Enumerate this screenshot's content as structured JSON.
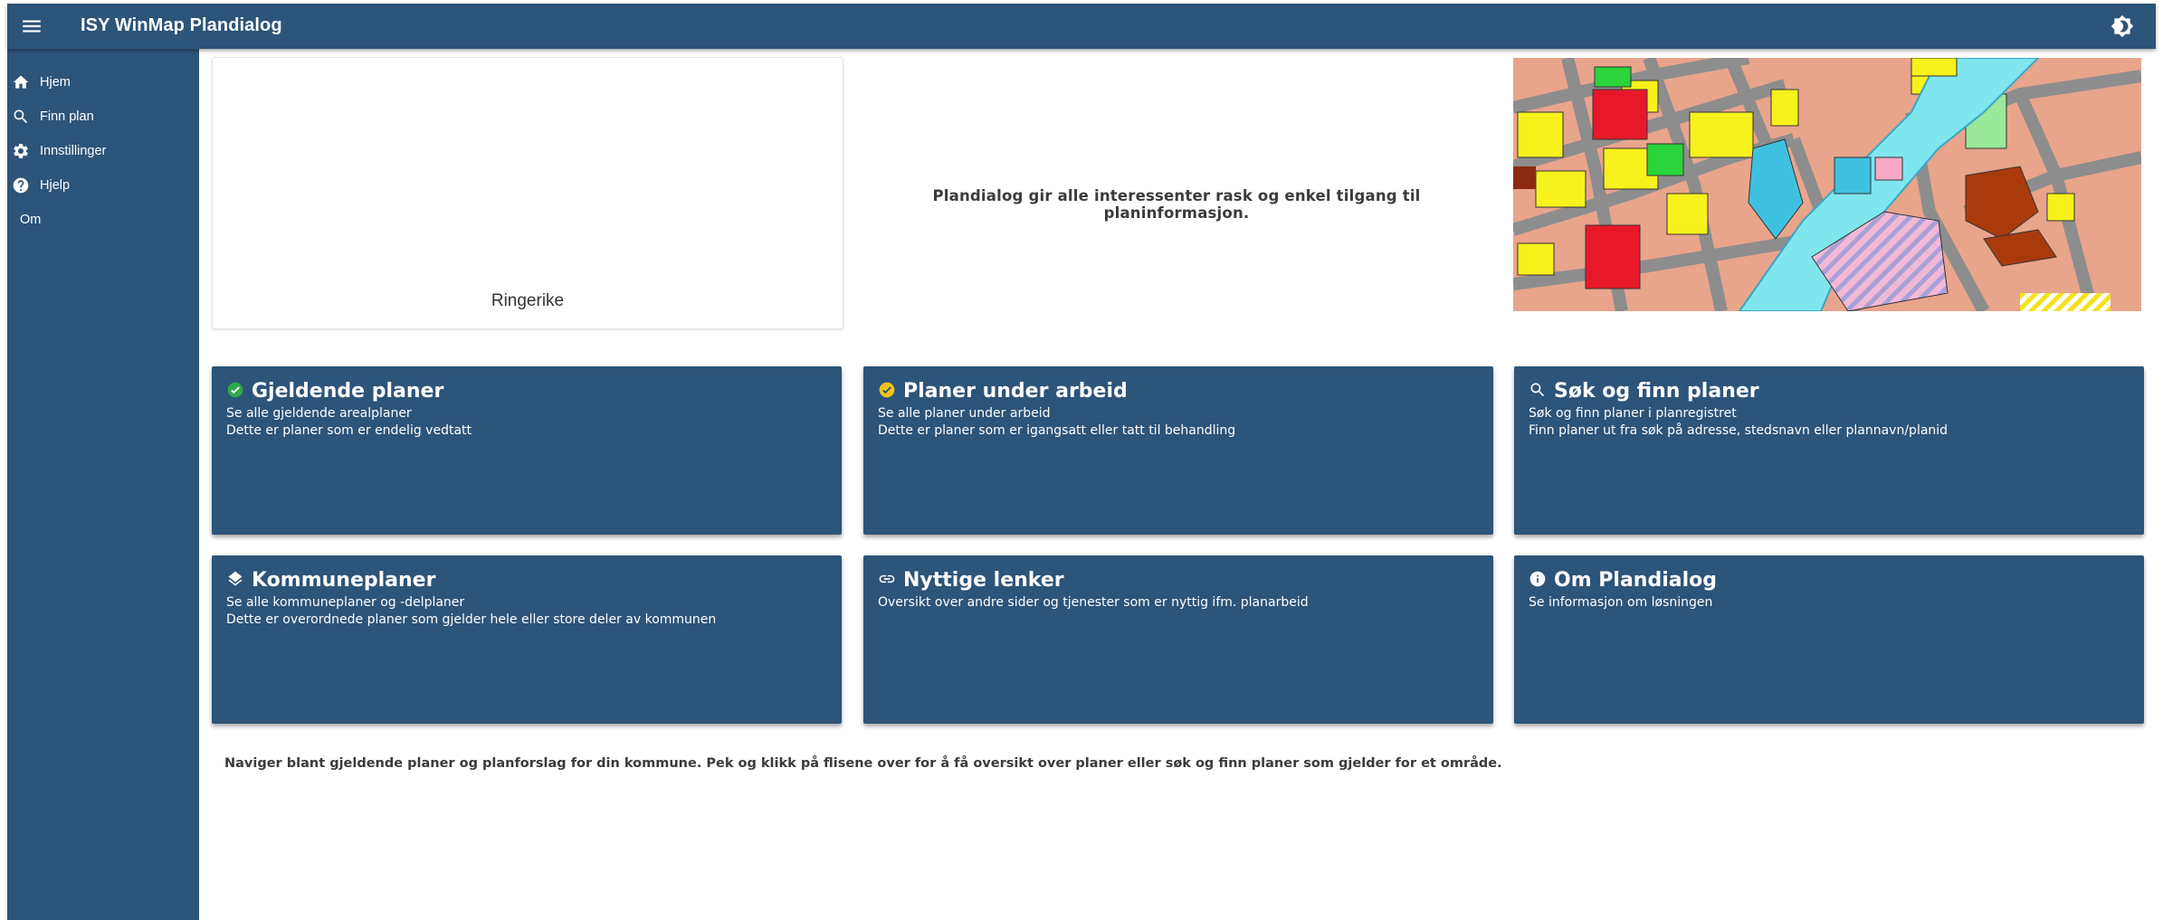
{
  "app": {
    "title": "ISY WinMap Plandialog"
  },
  "icons": {
    "menu": "menu-icon",
    "theme": "brightness-icon"
  },
  "sidebar": {
    "items": [
      {
        "label": "Hjem",
        "icon": "home-icon"
      },
      {
        "label": "Finn plan",
        "icon": "search-icon"
      },
      {
        "label": "Innstillinger",
        "icon": "gear-icon"
      },
      {
        "label": "Hjelp",
        "icon": "help-icon"
      },
      {
        "label": "Om",
        "icon": ""
      }
    ]
  },
  "municipality": {
    "name": "Ringerike"
  },
  "intro": "Plandialog gir alle interessenter rask og enkel tilgang til planinformasjon.",
  "tiles": [
    {
      "title": "Gjeldende planer",
      "line1": "Se alle gjeldende arealplaner",
      "line2": "Dette er planer som er endelig vedtatt",
      "icon": "check-circle-icon",
      "icon_color": "#2ea84a"
    },
    {
      "title": "Planer under arbeid",
      "line1": "Se alle planer under arbeid",
      "line2": "Dette er planer som er igangsatt eller tatt til behandling",
      "icon": "check-circle-icon",
      "icon_color": "#f0c419"
    },
    {
      "title": "Søk og finn planer",
      "line1": "Søk og finn planer i planregistret",
      "line2": "Finn planer ut fra søk på adresse, stedsnavn eller plannavn/planid",
      "icon": "search-icon",
      "icon_color": "#ffffff"
    },
    {
      "title": "Kommuneplaner",
      "line1": "Se alle kommuneplaner og -delplaner",
      "line2": "Dette er overordnede planer som gjelder hele eller store deler av kommunen",
      "icon": "layers-icon",
      "icon_color": "#ffffff"
    },
    {
      "title": "Nyttige lenker",
      "line1": "Oversikt over andre sider og tjenester som er nyttig ifm. planarbeid",
      "line2": "",
      "icon": "link-icon",
      "icon_color": "#ffffff"
    },
    {
      "title": "Om Plandialog",
      "line1": "Se informasjon om løsningen",
      "line2": "",
      "icon": "info-icon",
      "icon_color": "#ffffff"
    }
  ],
  "footer": "Naviger blant gjeldende planer og planforslag for din kommune. Pek og klikk på flisene over for å få oversikt over planer eller søk og finn planer som gjelder for et område.",
  "colors": {
    "primary": "#2d5479",
    "text": "#3b3b3b"
  }
}
